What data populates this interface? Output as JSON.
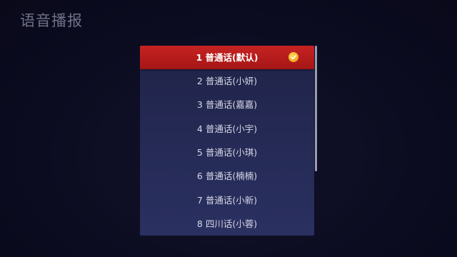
{
  "page": {
    "title": "语音播报"
  },
  "voice_list": {
    "items": [
      {
        "label": "1 普通话(默认)",
        "selected": true
      },
      {
        "label": "2 普通话(小妍)",
        "selected": false
      },
      {
        "label": "3 普通话(嘉嘉)",
        "selected": false
      },
      {
        "label": "4 普通话(小宇)",
        "selected": false
      },
      {
        "label": "5 普通话(小琪)",
        "selected": false
      },
      {
        "label": "6 普通话(楠楠)",
        "selected": false
      },
      {
        "label": "7 普通话(小新)",
        "selected": false
      },
      {
        "label": "8 四川话(小蓉)",
        "selected": false
      }
    ],
    "selected_icon": "check-circle-icon"
  },
  "colors": {
    "background": "#0b0b1f",
    "selected_row": "#b81c1c",
    "list_panel": "#252a55",
    "check_badge": "#f0a81c"
  }
}
